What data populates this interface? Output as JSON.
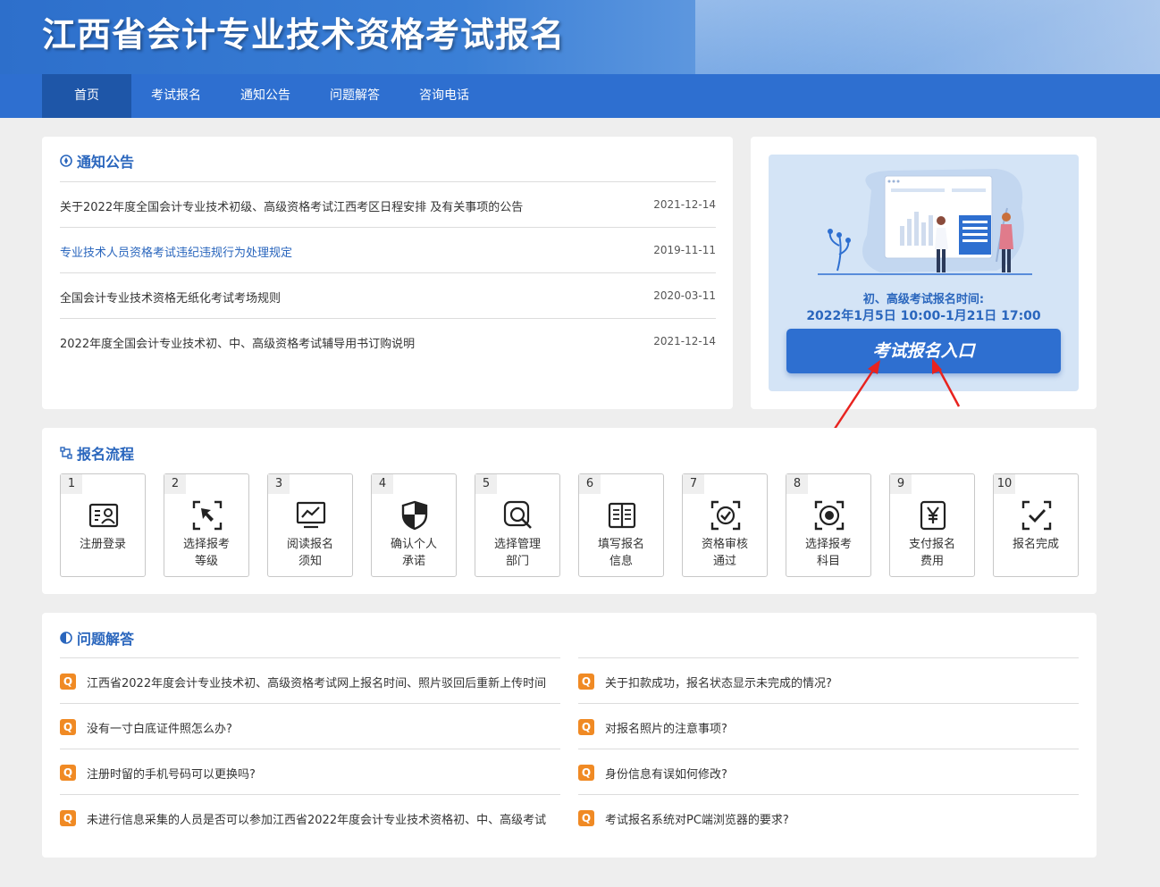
{
  "header": {
    "title": "江西省会计专业技术资格考试报名"
  },
  "nav": [
    {
      "label": "首页",
      "active": true
    },
    {
      "label": "考试报名",
      "active": false
    },
    {
      "label": "通知公告",
      "active": false
    },
    {
      "label": "问题解答",
      "active": false
    },
    {
      "label": "咨询电话",
      "active": false
    }
  ],
  "notices": {
    "title": "通知公告",
    "items": [
      {
        "title": "关于2022年度全国会计专业技术初级、高级资格考试江西考区日程安排 及有关事项的公告",
        "date": "2021-12-14"
      },
      {
        "title": "专业技术人员资格考试违纪违规行为处理规定",
        "date": "2019-11-11"
      },
      {
        "title": "全国会计专业技术资格无纸化考试考场规则",
        "date": "2020-03-11"
      },
      {
        "title": "2022年度全国会计专业技术初、中、高级资格考试辅导用书订购说明",
        "date": "2021-12-14"
      }
    ]
  },
  "entry": {
    "time_label": "初、高级考试报名时间:",
    "time_value": "2022年1月5日 10:00-1月21日 17:00",
    "button_label": "考试报名入口"
  },
  "process": {
    "title": "报名流程",
    "steps": [
      {
        "num": "1",
        "line1": "注册登录",
        "line2": "",
        "icon": "id-card-icon"
      },
      {
        "num": "2",
        "line1": "选择报考",
        "line2": "等级",
        "icon": "cursor-select-icon"
      },
      {
        "num": "3",
        "line1": "阅读报名",
        "line2": "须知",
        "icon": "monitor-chart-icon"
      },
      {
        "num": "4",
        "line1": "确认个人",
        "line2": "承诺",
        "icon": "shield-icon"
      },
      {
        "num": "5",
        "line1": "选择管理",
        "line2": "部门",
        "icon": "search-refresh-icon"
      },
      {
        "num": "6",
        "line1": "填写报名",
        "line2": "信息",
        "icon": "book-icon"
      },
      {
        "num": "7",
        "line1": "资格审核",
        "line2": "通过",
        "icon": "check-circle-icon"
      },
      {
        "num": "8",
        "line1": "选择报考",
        "line2": "科目",
        "icon": "target-icon"
      },
      {
        "num": "9",
        "line1": "支付报名",
        "line2": "费用",
        "icon": "yen-icon"
      },
      {
        "num": "10",
        "line1": "报名完成",
        "line2": "",
        "icon": "check-frame-icon"
      }
    ]
  },
  "faq": {
    "title": "问题解答",
    "badge": "Q",
    "left": [
      "江西省2022年度会计专业技术初、高级资格考试网上报名时间、照片驳回后重新上传时间",
      "没有一寸白底证件照怎么办?",
      "注册时留的手机号码可以更换吗?",
      "未进行信息采集的人员是否可以参加江西省2022年度会计专业技术资格初、中、高级考试"
    ],
    "right": [
      "关于扣款成功，报名状态显示未完成的情况?",
      "对报名照片的注意事项?",
      "身份信息有误如何修改?",
      "考试报名系统对PC端浏览器的要求?"
    ]
  },
  "colors": {
    "primary": "#2e6fd0",
    "nav_active": "#1e56a8",
    "accent_orange": "#f08a24",
    "arrow_red": "#e8231f",
    "link_blue": "#2a66bd"
  }
}
